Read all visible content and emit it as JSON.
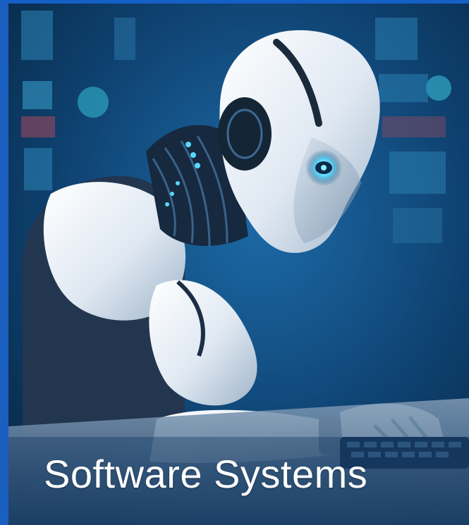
{
  "image": {
    "subject": "humanoid-robot-typing-on-keyboard",
    "colors": {
      "frame_border": "#1a5fbf",
      "background_dark": "#0b2f57",
      "background_light": "#1f6fae",
      "robot_shell": "#e8eef5",
      "glow": "#58d8ff"
    }
  },
  "caption": {
    "text": "Software Systems"
  }
}
